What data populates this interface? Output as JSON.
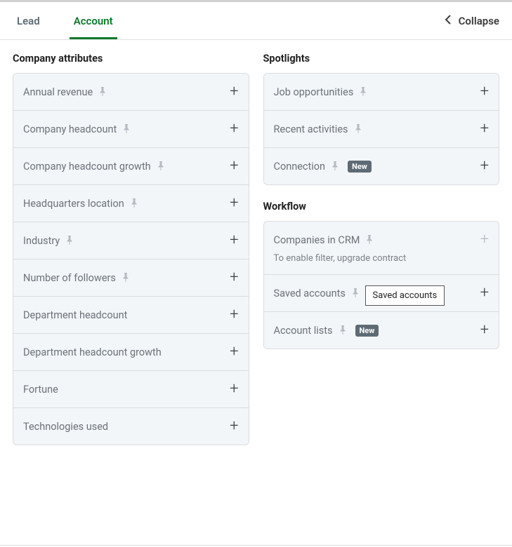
{
  "tabs": {
    "lead": "Lead",
    "account": "Account"
  },
  "collapse_label": "Collapse",
  "sections": {
    "company_attributes": {
      "title": "Company attributes",
      "items": [
        {
          "label": "Annual revenue",
          "pin": true
        },
        {
          "label": "Company headcount",
          "pin": true
        },
        {
          "label": "Company headcount growth",
          "pin": true
        },
        {
          "label": "Headquarters location",
          "pin": true
        },
        {
          "label": "Industry",
          "pin": true
        },
        {
          "label": "Number of followers",
          "pin": true
        },
        {
          "label": "Department headcount",
          "pin": false
        },
        {
          "label": "Department headcount growth",
          "pin": false
        },
        {
          "label": "Fortune",
          "pin": false
        },
        {
          "label": "Technologies used",
          "pin": false
        }
      ]
    },
    "spotlights": {
      "title": "Spotlights",
      "items": [
        {
          "label": "Job opportunities",
          "pin": true
        },
        {
          "label": "Recent activities",
          "pin": true
        },
        {
          "label": "Connection",
          "pin": true,
          "badge": "New"
        }
      ]
    },
    "workflow": {
      "title": "Workflow",
      "items": [
        {
          "label": "Companies in CRM",
          "pin": true,
          "subtext": "To enable filter, upgrade contract",
          "disabled": true
        },
        {
          "label": "Saved accounts",
          "pin": true,
          "tooltip": "Saved accounts"
        },
        {
          "label": "Account lists",
          "pin": true,
          "badge": "New"
        }
      ]
    }
  }
}
